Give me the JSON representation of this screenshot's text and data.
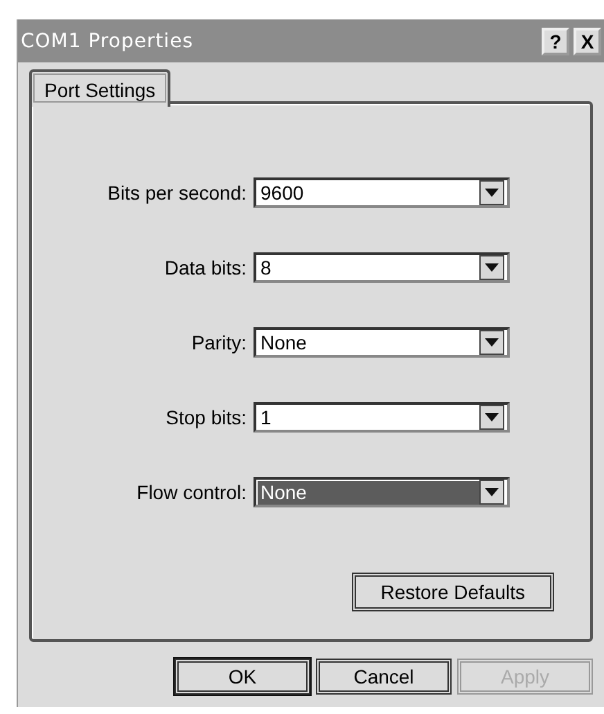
{
  "window": {
    "title": "COM1 Properties",
    "help": "?",
    "close": "X"
  },
  "tabs": [
    {
      "label": "Port Settings",
      "selected": true
    }
  ],
  "fields": [
    {
      "label": "Bits per second:",
      "value": "9600",
      "selected": false
    },
    {
      "label": "Data bits:",
      "value": "8",
      "selected": false
    },
    {
      "label": "Parity:",
      "value": "None",
      "selected": false
    },
    {
      "label": "Stop bits:",
      "value": "1",
      "selected": false
    },
    {
      "label": "Flow control:",
      "value": "None",
      "selected": true
    }
  ],
  "restore_button": "Restore Defaults",
  "buttons": [
    {
      "label": "OK",
      "default": true,
      "disabled": false
    },
    {
      "label": "Cancel",
      "default": false,
      "disabled": false
    },
    {
      "label": "Apply",
      "default": false,
      "disabled": true
    }
  ]
}
